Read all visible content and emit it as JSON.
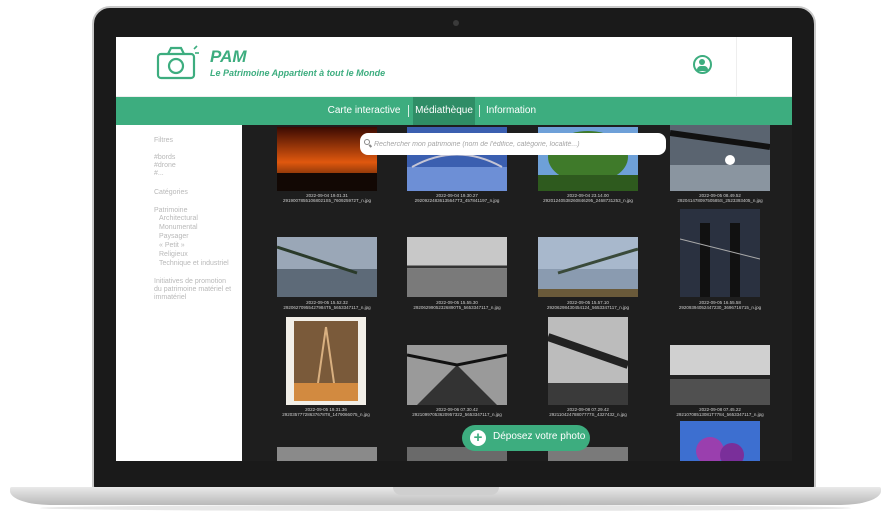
{
  "app": {
    "name": "PAM",
    "tagline": "Le Patrimoine Appartient à tout le Monde"
  },
  "colors": {
    "accent": "#3dad7f",
    "accent_dark": "#2f8d66",
    "gallery_bg": "#1e1e1e"
  },
  "nav": {
    "items": [
      {
        "label": "Carte interactive"
      },
      {
        "label": "Médiathèque",
        "active": true
      },
      {
        "label": "Information"
      }
    ]
  },
  "sidebar": {
    "filtres": "Filtres",
    "tags": [
      "#bords",
      "#drone",
      "#..."
    ],
    "categories_label": "Catégories",
    "patrimoine": "Patrimoine",
    "subcategories": [
      "Architectural",
      "Monumental",
      "Paysager",
      "« Petit »",
      "Religieux",
      "Technique et industriel"
    ],
    "initiatives": [
      "Initiatives de promotion",
      "du patrimoine matériel et",
      "immatériel"
    ]
  },
  "search": {
    "placeholder": "Rechercher mon patrimoine (nom de l'édifice, catégorie, localité...)"
  },
  "photos": [
    {
      "date": "2022-09-04 19.01.31",
      "file": "29190078551068021S5_760925972T_n.jpg",
      "icon": "sunset-photo"
    },
    {
      "date": "2022-09-04 19.30.27",
      "file": "29209224836135647T3_457841197_n.jpg",
      "icon": "river-bridge-photo"
    },
    {
      "date": "2022-09-04 23.14.00",
      "file": "29201240538260846295_2468731253_n.jpg",
      "icon": "tree-photo"
    },
    {
      "date": "2022-09-05 08.49.52",
      "file": "29204147809750585S_2523393405_n.jpg",
      "icon": "bridge-silhouette-photo"
    },
    {
      "date": "2022-09-05 15.52.32",
      "file": "29206270955427984T5_5653347117_n.jpg",
      "icon": "bridge-photo"
    },
    {
      "date": "2022-09-05 15.55.30",
      "file": "29206299052326890T5_5653347117_n.jpg",
      "icon": "bridge-photo"
    },
    {
      "date": "2022-09-05 15.57.10",
      "file": "29206298430454124_5653347117_n.jpg",
      "icon": "bridge-photo"
    },
    {
      "date": "2022-09-05 16.55.58",
      "file": "29209394052447230_3696716715_n.jpg",
      "icon": "suspension-bridge-photo"
    },
    {
      "date": "2022-09-05 19.31.36",
      "file": "29203577728637678T8_1479066075_n.jpg",
      "icon": "tower-photo"
    },
    {
      "date": "2022-09-06 07.30.42",
      "file": "29210997053620957322_5653347117_n.jpg",
      "icon": "bridge-road-photo"
    },
    {
      "date": "2022-09-08 07.29.42",
      "file": "29211042478807777S_4327432_n.jpg",
      "icon": "bridge-photo"
    },
    {
      "date": "2022-09-08 07.45.22",
      "file": "29210708513081T7784_5653347117_n.jpg",
      "icon": "river-photo"
    },
    {
      "date": "",
      "file": "",
      "icon": "bridge-photo"
    },
    {
      "date": "",
      "file": "",
      "icon": "bridge-photo"
    },
    {
      "date": "",
      "file": "",
      "icon": "bridge-photo"
    },
    {
      "date": "",
      "file": "",
      "icon": "flowers-photo"
    }
  ],
  "fab": {
    "label": "Déposez votre photo",
    "icon": "plus-icon"
  }
}
